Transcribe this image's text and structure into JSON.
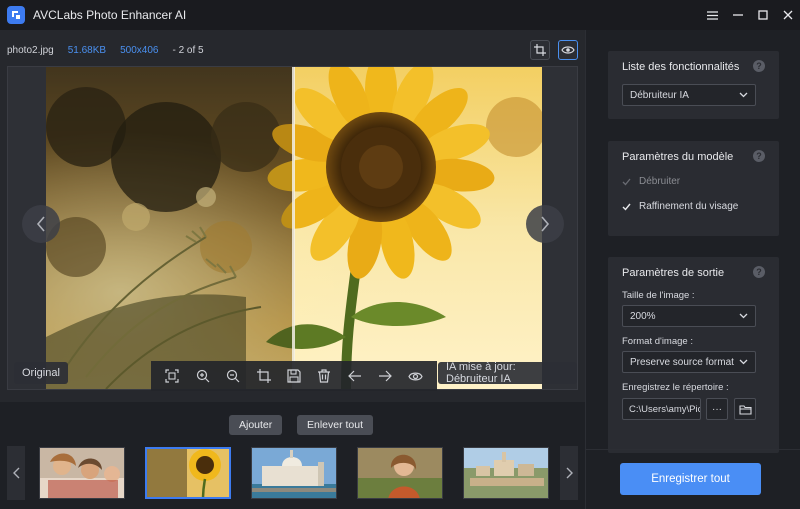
{
  "app": {
    "title": "AVCLabs Photo Enhancer AI"
  },
  "colors": {
    "accent": "#3d7bf0",
    "info_blue": "#4a90f0",
    "primary_button": "#4a8ef5"
  },
  "info": {
    "filename": "photo2.jpg",
    "filesize": "51.68KB",
    "dimensions": "500x406",
    "page_count": "- 2 of 5"
  },
  "preview": {
    "original_label": "Original",
    "ai_label": "IA mise à jour: Débruiteur IA"
  },
  "list": {
    "add_label": "Ajouter",
    "remove_all_label": "Enlever tout"
  },
  "panel": {
    "features": {
      "title": "Liste des fonctionnalités",
      "selected": "Débruiteur IA"
    },
    "model": {
      "title": "Paramètres du modèle",
      "options": [
        {
          "label": "Débruiter",
          "checked": true,
          "disabled": true
        },
        {
          "label": "Raffinement du visage",
          "checked": true,
          "disabled": false
        }
      ]
    },
    "output": {
      "title": "Paramètres de sortie",
      "size_label": "Taille de l'image :",
      "size_value": "200%",
      "format_label": "Format d'image :",
      "format_value": "Preserve source format",
      "dir_label": "Enregistrez le répertoire :",
      "dir_value": "C:\\Users\\amy\\Pictures",
      "more_label": "···"
    },
    "save_all_label": "Enregistrer tout"
  }
}
